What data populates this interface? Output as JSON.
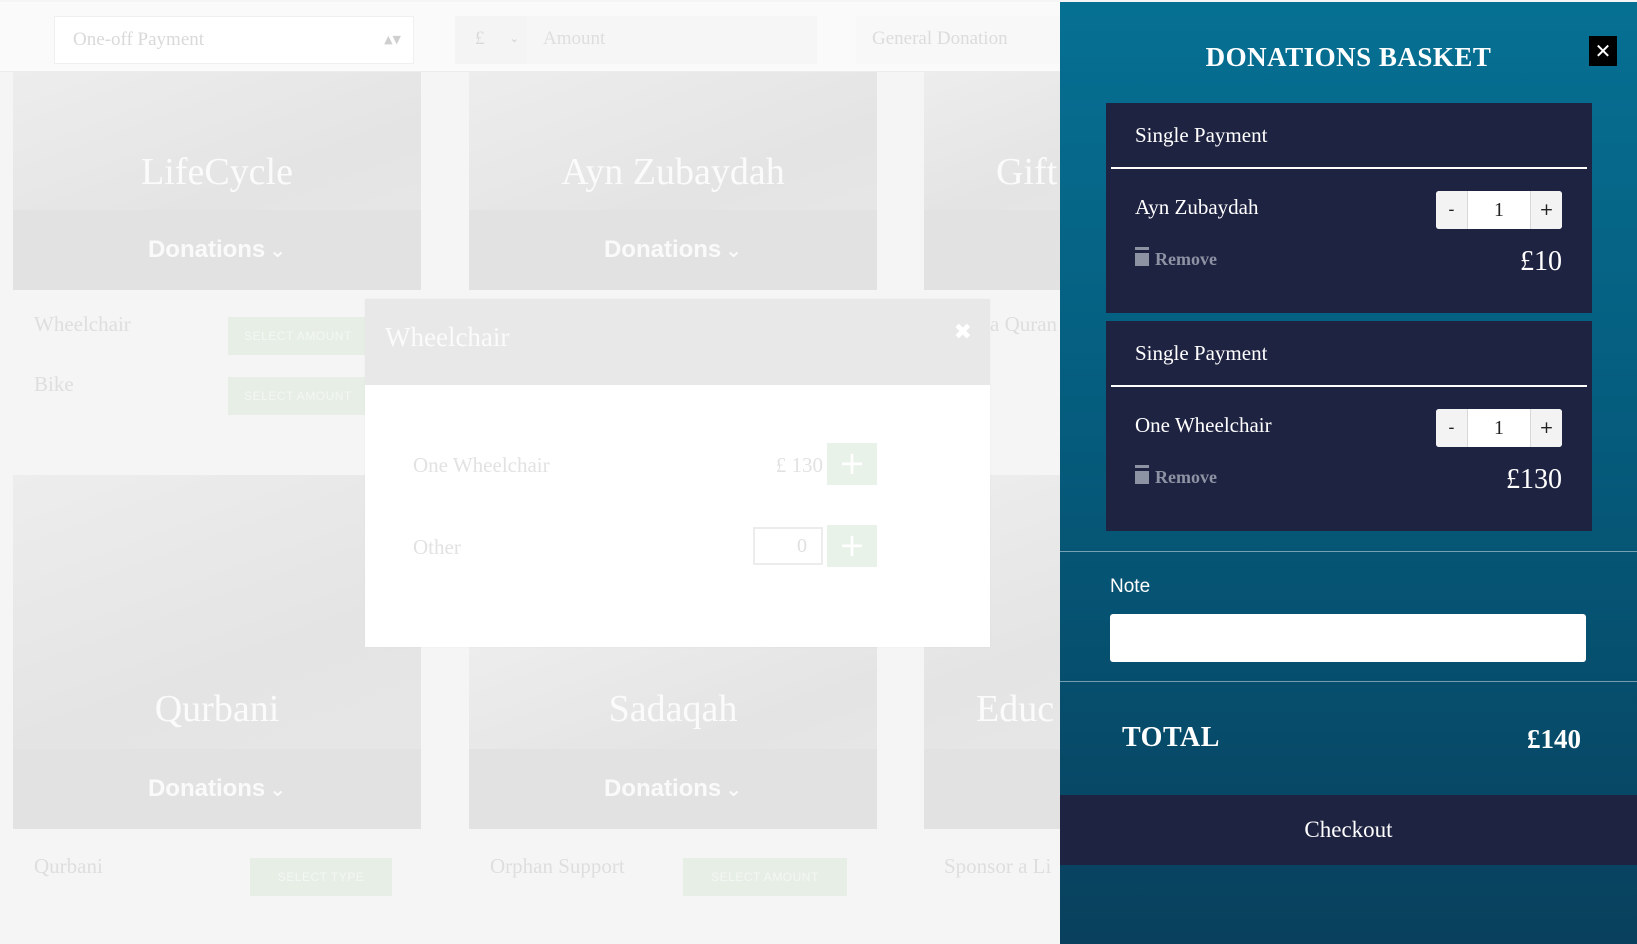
{
  "background": {
    "topbar": {
      "payment_type": "One-off Payment",
      "currency": "£",
      "amount_placeholder": "Amount",
      "donation_type": "General Donation"
    },
    "cards": [
      {
        "title": "LifeCycle",
        "footer": "Donations"
      },
      {
        "title": "Ayn Zubaydah",
        "footer": "Donations"
      },
      {
        "title": "Gift",
        "footer": "Donations"
      },
      {
        "title": "Qurbani",
        "footer": "Donations"
      },
      {
        "title": "Sadaqah",
        "footer": "Donations"
      },
      {
        "title": "Educ",
        "footer": "Donations"
      }
    ],
    "labels": {
      "wheelchair": "Wheelchair",
      "bike": "Bike",
      "quran": "a Quran",
      "qurbani": "Qurbani",
      "orphan": "Orphan Support",
      "sponsor": "Sponsor a Li"
    },
    "buttons": {
      "select_amount": "SELECT AMOUNT",
      "select_type": "SELECT TYPE"
    }
  },
  "modal": {
    "title": "Wheelchair",
    "rows": [
      {
        "label": "One Wheelchair",
        "price": "£ 130"
      },
      {
        "label": "Other",
        "qty": "0"
      }
    ]
  },
  "basket": {
    "title": "DONATIONS BASKET",
    "items": [
      {
        "payment_type": "Single Payment",
        "name": "Ayn Zubaydah",
        "qty": "1",
        "price": "£10",
        "remove": "Remove"
      },
      {
        "payment_type": "Single Payment",
        "name": "One Wheelchair",
        "qty": "1",
        "price": "£130",
        "remove": "Remove"
      }
    ],
    "note_label": "Note",
    "total_label": "TOTAL",
    "total_value": "£140",
    "checkout": "Checkout"
  },
  "icons": {
    "close": "close-icon",
    "trash": "trash-icon",
    "chevron": "double-chevron-down-icon",
    "plus": "plus-icon"
  },
  "colors": {
    "basket_top": "#067093",
    "basket_bottom": "#08405d",
    "item_bg": "#1f2342",
    "checkout_bg": "#1f2342"
  }
}
